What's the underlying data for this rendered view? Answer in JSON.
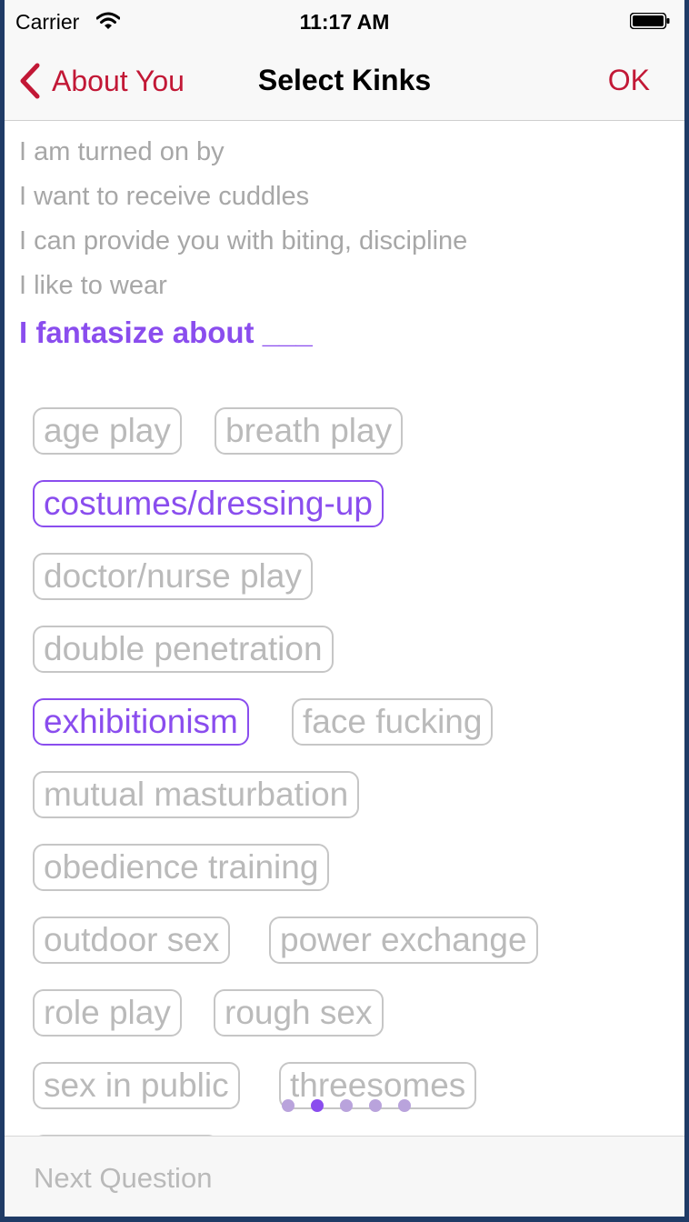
{
  "status_bar": {
    "carrier": "Carrier",
    "time": "11:17 AM",
    "icons": [
      "wifi-icon",
      "battery-icon"
    ]
  },
  "nav": {
    "back_label": "About You",
    "title": "Select Kinks",
    "ok_label": "OK",
    "back_icon": "chevron-left-icon"
  },
  "prompts": [
    "I am turned on by",
    "I want to receive cuddles",
    "I can provide you with biting, discipline",
    "I like to wear"
  ],
  "active_prompt": "I fantasize about ___",
  "tags": [
    {
      "label": "age play",
      "selected": false
    },
    {
      "label": "breath play",
      "selected": false
    },
    {
      "label": "costumes/dressing-up",
      "selected": true
    },
    {
      "label": "doctor/nurse play",
      "selected": false
    },
    {
      "label": "double penetration",
      "selected": false
    },
    {
      "label": "exhibitionism",
      "selected": true
    },
    {
      "label": "face fucking",
      "selected": false
    },
    {
      "label": "mutual masturbation",
      "selected": false
    },
    {
      "label": "obedience training",
      "selected": false
    },
    {
      "label": "outdoor sex",
      "selected": false
    },
    {
      "label": "power exchange",
      "selected": false
    },
    {
      "label": "role play",
      "selected": false
    },
    {
      "label": "rough sex",
      "selected": false
    },
    {
      "label": "sex in public",
      "selected": false
    },
    {
      "label": "threesomes",
      "selected": false
    }
  ],
  "pager": {
    "count": 5,
    "active_index": 1
  },
  "bottom": {
    "next_label": "Next Question"
  },
  "colors": {
    "accent": "#8a4dee",
    "nav_tint": "#c21836",
    "tag_unselected": "#bababa",
    "prompt_text": "#a7a7a7"
  }
}
